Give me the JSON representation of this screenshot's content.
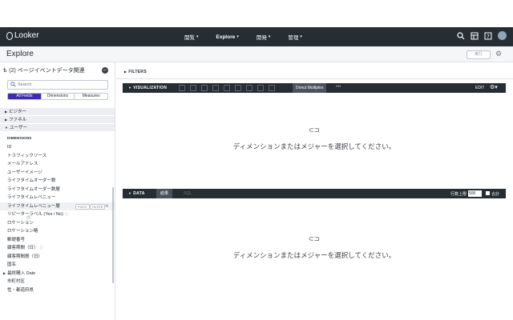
{
  "app": {
    "logo_text": "Looker"
  },
  "nav": {
    "items": [
      "閲覧",
      "Explore",
      "開発",
      "管理"
    ]
  },
  "page": {
    "title": "Explore",
    "run_label": "実行"
  },
  "sidebar": {
    "explore_title": "(2) ページイベントデータ関連",
    "search_placeholder": "Search",
    "tabs": [
      "All Fields",
      "Dimensions",
      "Measures"
    ],
    "groups": [
      "ビジター",
      "ファネル",
      "ユーザー"
    ],
    "dimensions_title": "DIMENSIONS",
    "fields": [
      "ID",
      "トラフィックソース",
      "メールアドレス",
      "ユーザーイメージ",
      "ライフタイムオーダー数",
      "ライフタイムオーダー数層",
      "ライフタイムレベニュー",
      "ライフタイムレベニュー層",
      "リピーターラベル (Yes / No)",
      "ロケーション",
      "ロケーション略",
      "郵便番号",
      "顧客期間（日）",
      "顧客期間層（日）",
      "国名",
      "最終購入 Date",
      "市町村区",
      "性・都道府県"
    ],
    "pivot_label": "PIVOT",
    "filter_label": "FILTER"
  },
  "main": {
    "filters_label": "FILTERS",
    "visualization_label": "VISUALIZATION",
    "vis_active_tab": "Donut Multiples",
    "more_label": "•••",
    "edit_label": "EDIT",
    "empty_message": "ディメンションまたはメジャーを選択してください。",
    "data_label": "DATA",
    "tab_results": "結果",
    "tab_sql": "SQL",
    "row_limit_label": "行数上限",
    "row_limit_value": "500",
    "total_label": "合計"
  },
  "icons": [
    "search-icon",
    "grid-icon",
    "help-icon",
    "gear-icon",
    "caret-down-icon",
    "caret-right-icon",
    "info-icon",
    "sparkle-icon"
  ]
}
